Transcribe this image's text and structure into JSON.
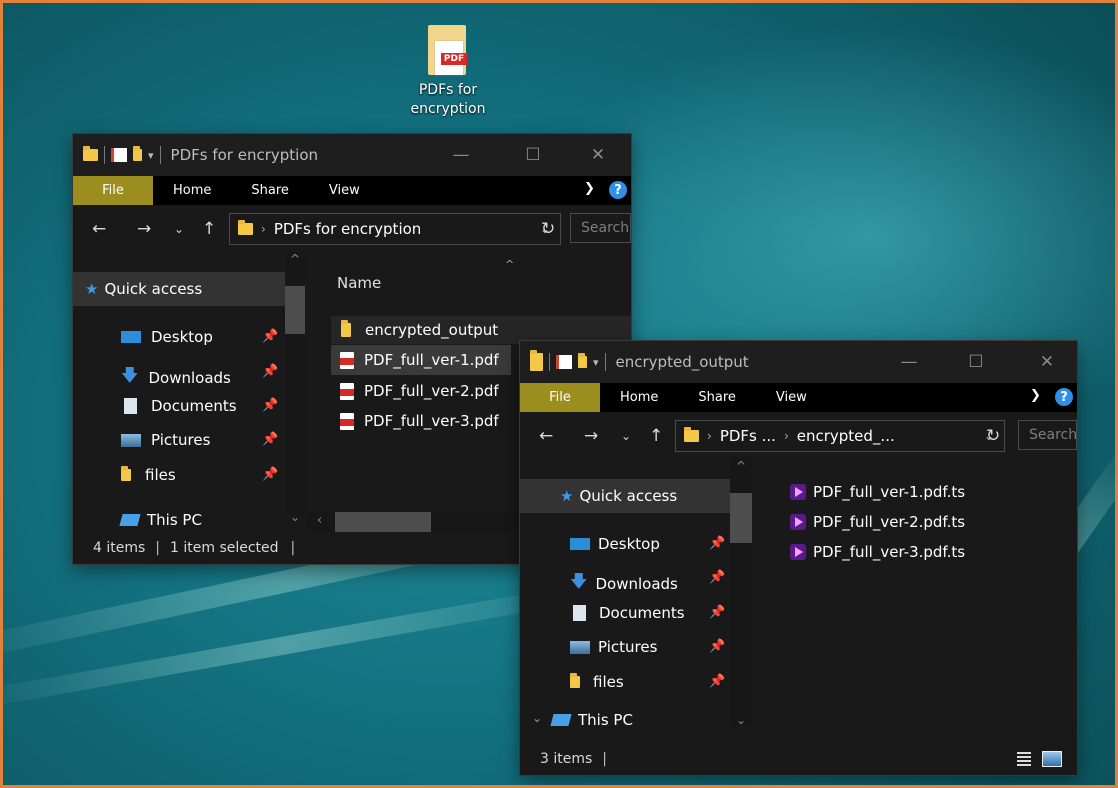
{
  "desktop": {
    "icon_label_line1": "PDFs for",
    "icon_label_line2": "encryption"
  },
  "win1": {
    "title": "PDFs for encryption",
    "tabs": [
      "File",
      "Home",
      "Share",
      "View"
    ],
    "breadcrumb": "PDFs for encryption",
    "search_placeholder": "Search",
    "column_header": "Name",
    "nav": {
      "quick_access": "Quick access",
      "items": [
        "Desktop",
        "Downloads",
        "Documents",
        "Pictures",
        "files"
      ],
      "this_pc": "This PC"
    },
    "files": [
      "encrypted_output",
      "PDF_full_ver-1.pdf",
      "PDF_full_ver-2.pdf",
      "PDF_full_ver-3.pdf"
    ],
    "status": {
      "count": "4 items",
      "selected": "1 item selected"
    }
  },
  "win2": {
    "title": "encrypted_output",
    "tabs": [
      "File",
      "Home",
      "Share",
      "View"
    ],
    "breadcrumb_1": "PDFs ...",
    "breadcrumb_2": "encrypted_...",
    "search_placeholder": "Search",
    "nav": {
      "quick_access": "Quick access",
      "items": [
        "Desktop",
        "Downloads",
        "Documents",
        "Pictures",
        "files"
      ],
      "this_pc": "This PC"
    },
    "files": [
      "PDF_full_ver-1.pdf.ts",
      "PDF_full_ver-2.pdf.ts",
      "PDF_full_ver-3.pdf.ts"
    ],
    "status": {
      "count": "3 items"
    }
  },
  "colors": {
    "frame": "#e0823b",
    "file_tab": "#9b8d1e",
    "selected_row": "#3a3a3a",
    "help": "#2f8fe6",
    "star": "#3d9ae8"
  }
}
